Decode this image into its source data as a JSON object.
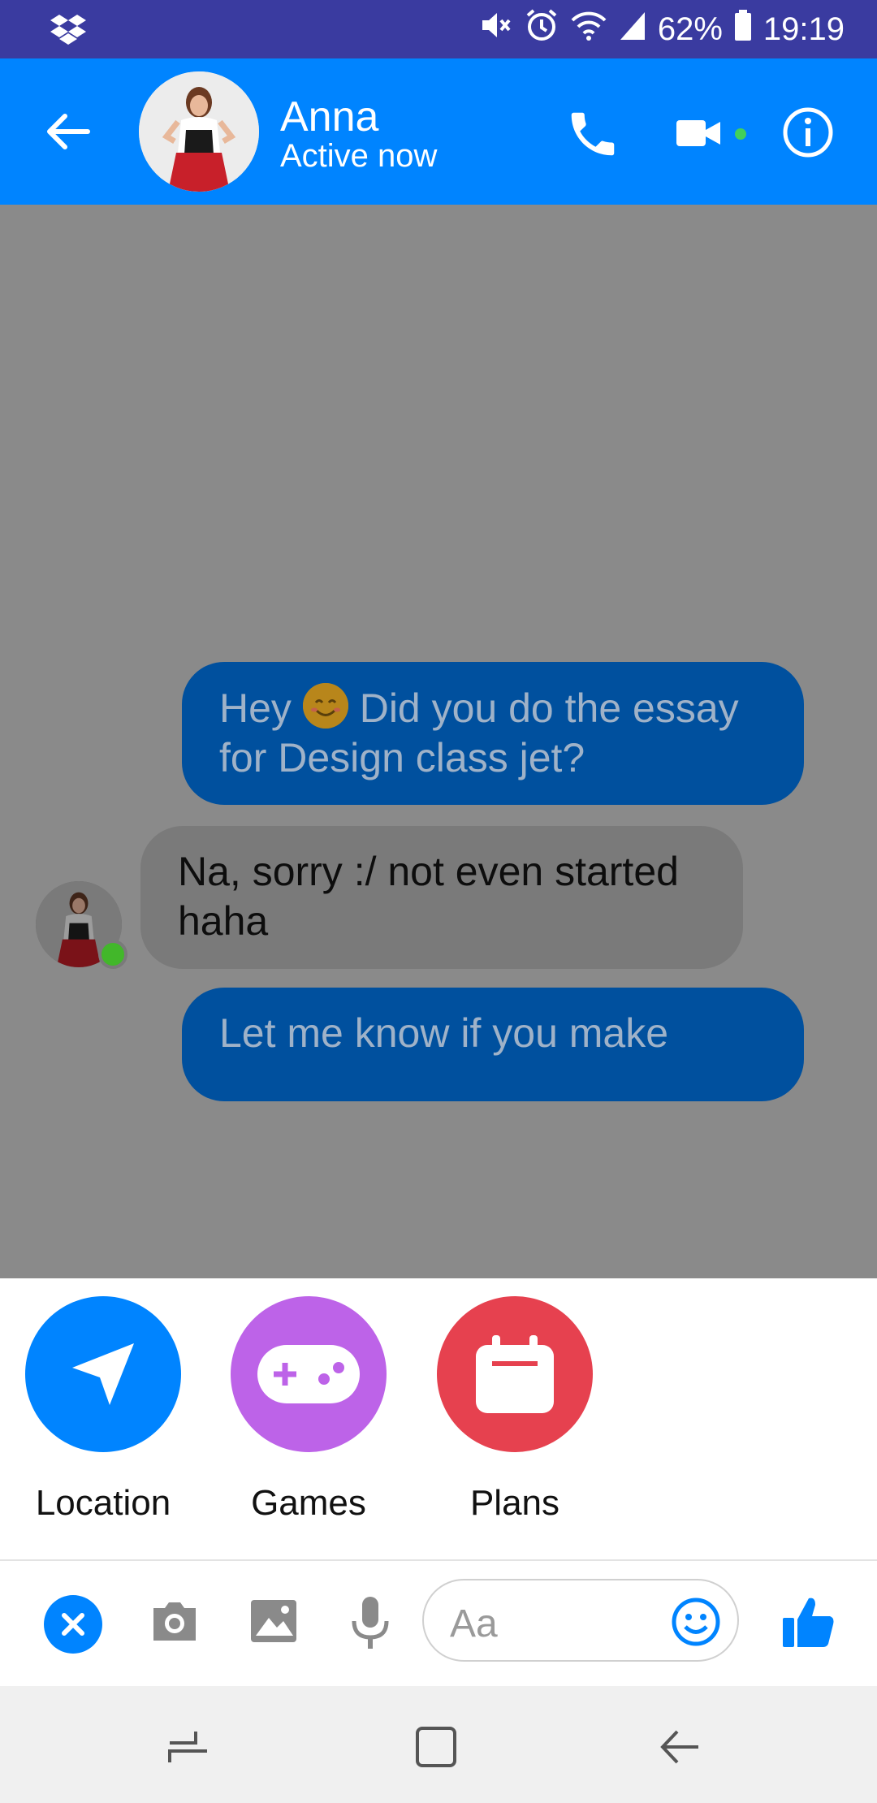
{
  "status_bar": {
    "battery": "62%",
    "time": "19:19",
    "icons": [
      "dropbox-icon",
      "mute-icon",
      "alarm-icon",
      "wifi-icon",
      "signal-icon",
      "battery-icon"
    ]
  },
  "header": {
    "contact_name": "Anna",
    "contact_status": "Active now",
    "icons": [
      "back-arrow-icon",
      "phone-icon",
      "video-camera-icon",
      "info-icon"
    ],
    "accent_color": "#0084ff"
  },
  "messages": [
    {
      "direction": "outgoing",
      "text_before_emoji": "Hey ",
      "emoji": "smiling-face-emoji",
      "text_after_emoji": " Did you do the essay for Design class jet?"
    },
    {
      "direction": "incoming",
      "text": "Na, sorry :/ not even started haha"
    },
    {
      "direction": "outgoing",
      "text": "Let me know if you make"
    }
  ],
  "sheet": {
    "items": [
      {
        "label": "Location",
        "icon": "navigation-arrow-icon",
        "color": "#0084ff"
      },
      {
        "label": "Games",
        "icon": "gamepad-icon",
        "color": "#bd63e8"
      },
      {
        "label": "Plans",
        "icon": "calendar-icon",
        "color": "#e6414f"
      }
    ]
  },
  "composer": {
    "placeholder": "Aa",
    "icons": [
      "close-icon",
      "camera-icon",
      "image-icon",
      "microphone-icon",
      "emoji-icon",
      "thumbs-up-icon"
    ]
  },
  "nav_bar": {
    "icons": [
      "recents-icon",
      "home-icon",
      "back-icon"
    ]
  }
}
